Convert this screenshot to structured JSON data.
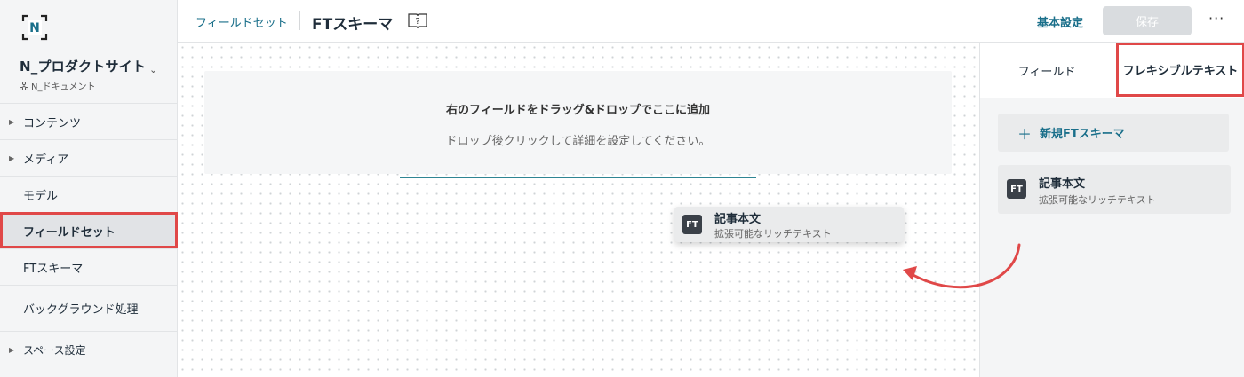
{
  "sidebar": {
    "project_name": "N_プロダクトサイト",
    "project_sub": "N_ドキュメント",
    "items": [
      {
        "label": "コンテンツ"
      },
      {
        "label": "メディア"
      },
      {
        "label": "モデル"
      },
      {
        "label": "フィールドセット"
      },
      {
        "label": "FTスキーマ"
      },
      {
        "label": "バックグラウンド処理"
      },
      {
        "label": "スペース設定"
      }
    ]
  },
  "header": {
    "breadcrumb": "フィールドセット",
    "title": "FTスキーマ",
    "basic_settings": "基本設定",
    "save": "保存",
    "more": "···"
  },
  "canvas": {
    "drop_title": "右のフィールドをドラッグ&ドロップでここに追加",
    "drop_sub": "ドロップ後クリックして詳細を設定してください。",
    "drag_card": {
      "badge": "FT",
      "title": "記事本文",
      "sub": "拡張可能なリッチテキスト"
    }
  },
  "panel": {
    "tabs": [
      {
        "label": "フィールド"
      },
      {
        "label": "フレキシブルテキスト"
      }
    ],
    "new_schema": "新規FTスキーマ",
    "schema_card": {
      "badge": "FT",
      "title": "記事本文",
      "sub": "拡張可能なリッチテキスト"
    }
  },
  "colors": {
    "accent": "#1a6f8a",
    "highlight": "#e04848",
    "dropline": "#2f8593"
  }
}
